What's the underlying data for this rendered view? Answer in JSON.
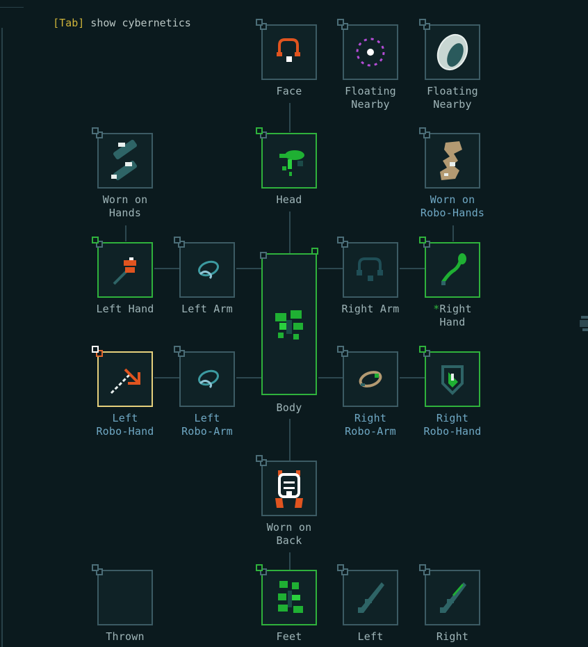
{
  "header": {
    "tab_key": "[Tab]",
    "text": " show cybernetics"
  },
  "colors": {
    "background": "#0b1a1e",
    "slot_border": "#3c5b64",
    "equipped_border": "#2fb23c",
    "selected_border": "#e6d07c",
    "label": "#9fb5b8",
    "robo_label": "#6fa8c4",
    "tab_key": "#cfb43a"
  },
  "slots": {
    "face": {
      "label": "Face",
      "icon": "headset-icon"
    },
    "floating_1": {
      "label": "Floating\nNearby",
      "icon": "floating-orb-icon"
    },
    "floating_2": {
      "label": "Floating\nNearby",
      "icon": "floating-disc-icon"
    },
    "worn_on_hands": {
      "label": "Worn on\nHands",
      "icon": "bandage-wraps-icon"
    },
    "head": {
      "label": "Head",
      "icon": "plant-head-icon"
    },
    "worn_on_robo_hands": {
      "label": "Worn on\nRobo-Hands",
      "icon": "tan-wraps-icon"
    },
    "left_hand": {
      "label": "Left Hand",
      "icon": "red-wrench-icon"
    },
    "left_arm": {
      "label": "Left Arm",
      "icon": "arm-coil-icon"
    },
    "body": {
      "label": "Body",
      "icon": "leafy-body-icon"
    },
    "right_arm": {
      "label": "Right Arm",
      "icon": "headset-icon"
    },
    "right_hand": {
      "star": "*",
      "label": "Right\nHand",
      "icon": "green-vine-icon"
    },
    "left_robo_hand": {
      "label": "Left\nRobo-Hand",
      "icon": "robo-arrow-tool-icon"
    },
    "left_robo_arm": {
      "label": "Left\nRobo-Arm",
      "icon": "arm-coil-icon"
    },
    "right_robo_arm": {
      "label": "Right\nRobo-Arm",
      "icon": "tan-ring-icon"
    },
    "right_robo_hand": {
      "label": "Right\nRobo-Hand",
      "icon": "green-shield-icon"
    },
    "worn_on_back": {
      "label": "Worn on\nBack",
      "icon": "jetpack-icon"
    },
    "thrown": {
      "label": "Thrown",
      "icon": ""
    },
    "feet": {
      "label": "Feet",
      "icon": "leafy-feet-icon"
    },
    "left_missile": {
      "label": "Left",
      "icon": "rifle-icon"
    },
    "right_missile": {
      "label": "Right",
      "icon": "green-rifle-icon"
    }
  }
}
